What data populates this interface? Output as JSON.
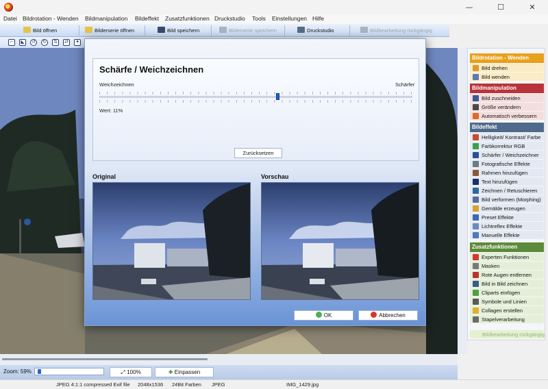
{
  "menu": [
    "Datei",
    "Bildrotation - Wenden",
    "Bildmanipulation",
    "Bildeffekt",
    "Zusatzfunktionen",
    "Druckstudio",
    "Tools",
    "Einstellungen",
    "Hilfe"
  ],
  "toolbar": {
    "open": "Bild öffnen",
    "open_series": "Bilderserie öffnen",
    "save": "Bild speichern",
    "save_series": "Bilderserie speichern",
    "print_studio": "Druckstudio",
    "undo": "Bildbearbeitung rückgängig"
  },
  "dialog": {
    "title": "Schärfe / Weichzeichnen",
    "left_label": "Weichzeichnen",
    "right_label": "Schärfer",
    "value_text": "Wert: 11%",
    "slider_value": 0.57,
    "reset": "Zurücksetzen",
    "original": "Original",
    "preview": "Vorschau",
    "ok": "OK",
    "cancel": "Abbrechen"
  },
  "panel": {
    "rotation": {
      "title": "Bildrotation - Wenden",
      "items": [
        "Bild drehen",
        "Bild wenden"
      ]
    },
    "manipulation": {
      "title": "Bildmanipulation",
      "items": [
        "Bild zuschneiden",
        "Größe verändern",
        "Automatisch verbessern"
      ]
    },
    "effect": {
      "title": "Bildeffekt",
      "items": [
        "Helligkeit/ Kontrast/ Farbe",
        "Farbkorrektur RGB",
        "Schärfer / Weichzeichner",
        "Fotografische Effekte",
        "Rahmen hinzufügen",
        "Text hinzufügen",
        "Zeichnen / Retuschieren",
        "Bild verformen (Morphing)",
        "Gemälde erzeugen",
        "Preset Effekte",
        "Lichtreflex Effekte",
        "Manuelle Effekte"
      ]
    },
    "extra": {
      "title": "Zusatzfunktionen",
      "items": [
        "Experten Funktionen",
        "Masken",
        "Rote Augen entfernen",
        "Bild in Bild zeichnen",
        "Cliparts einfügen",
        "Symbole und Linien",
        "Collagen erstellen",
        "Stapelverarbeitung"
      ]
    },
    "undo": "Bildbearbeitung rückgängig"
  },
  "zoom": {
    "label": "Zoom: 59%",
    "level": 0.59,
    "btn100": "100%",
    "fit": "Einpassen"
  },
  "status": {
    "format": "JPEG 4:1:1 compressed Exif file",
    "size": "2048x1536",
    "colors": "24Bit Farben",
    "type": "JPEG",
    "filename": "IMG_1429.jpg"
  },
  "colors": {
    "rotation": "#e89a1c",
    "manipulation": "#b8343a",
    "effect": "#4f6a8a",
    "extra": "#5d8a3a",
    "accent": "#1e5fc9"
  }
}
